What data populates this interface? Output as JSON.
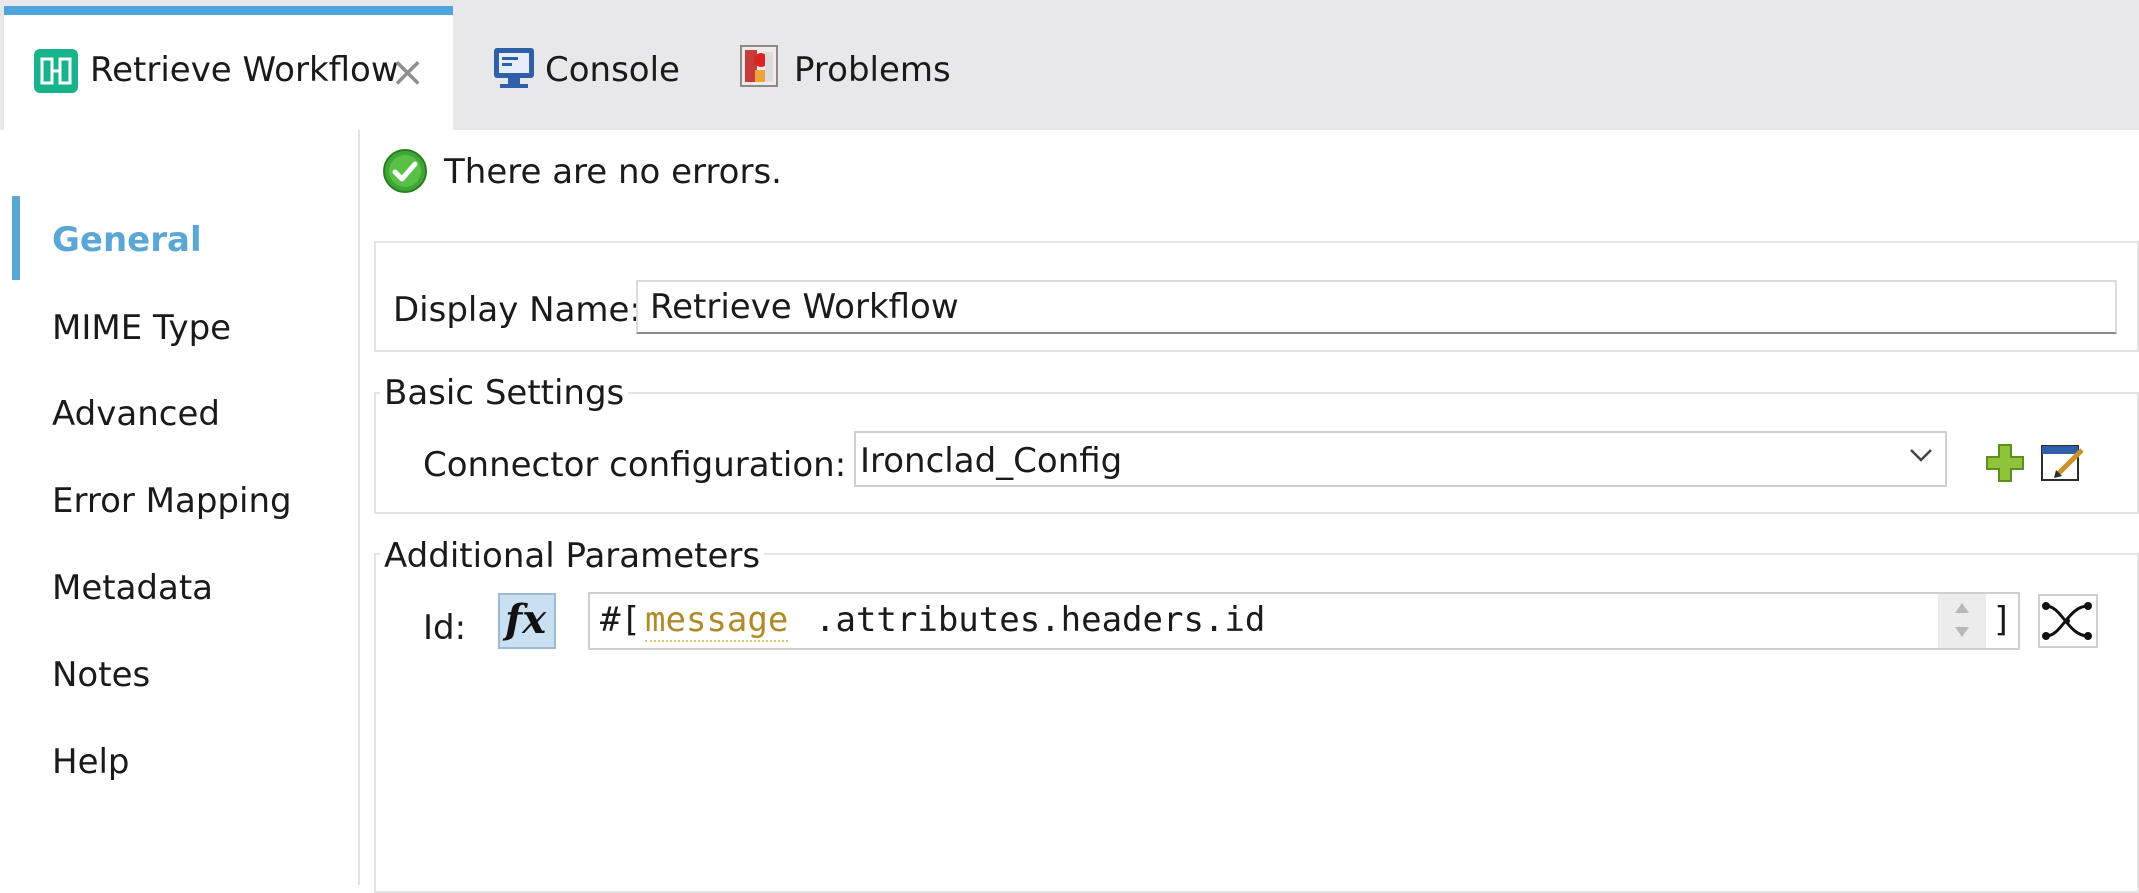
{
  "tabs": [
    {
      "label": "Retrieve Workflow",
      "icon": "mule-component-icon",
      "active": true
    },
    {
      "label": "Console",
      "icon": "console-icon"
    },
    {
      "label": "Problems",
      "icon": "problems-icon"
    }
  ],
  "tab_close_label": "×",
  "status": {
    "text": "There are no errors.",
    "icon": "check-circle-icon"
  },
  "nav": {
    "items": [
      "General",
      "MIME Type",
      "Advanced",
      "Error Mapping",
      "Metadata",
      "Notes",
      "Help"
    ],
    "active": "General"
  },
  "display_name": {
    "label": "Display Name:",
    "value": "Retrieve Workflow"
  },
  "basic_settings": {
    "title": "Basic Settings",
    "connector_label": "Connector configuration:",
    "connector_value": "Ironclad_Config"
  },
  "additional_parameters": {
    "title": "Additional Parameters",
    "id_label": "Id:",
    "fx_label": "fx",
    "expr_prefix": "#[",
    "expr_variable": "message",
    "expr_rest": ".attributes.headers.id",
    "expr_suffix": "]"
  },
  "colors": {
    "accent": "#4fa3de",
    "nav_active": "#5aa7d6",
    "expr_variable": "#b08a2a",
    "success": "#3fa535"
  }
}
